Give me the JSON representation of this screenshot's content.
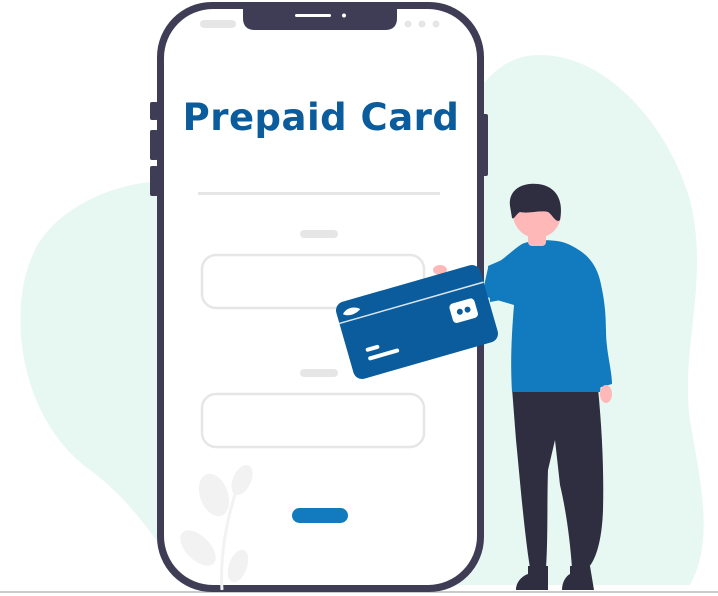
{
  "illustration": {
    "title": "Prepaid Card"
  },
  "colors": {
    "brand": "#0b5c9c",
    "accent": "#127bbf",
    "phone_frame": "#3f3d56",
    "blob": "#e7f8f2",
    "card": "#0b5c9c",
    "shirt": "#127bbf",
    "pants": "#2f2e41",
    "skin": "#ffb8b8",
    "hair": "#2f2e41",
    "ground": "#cacaca"
  }
}
